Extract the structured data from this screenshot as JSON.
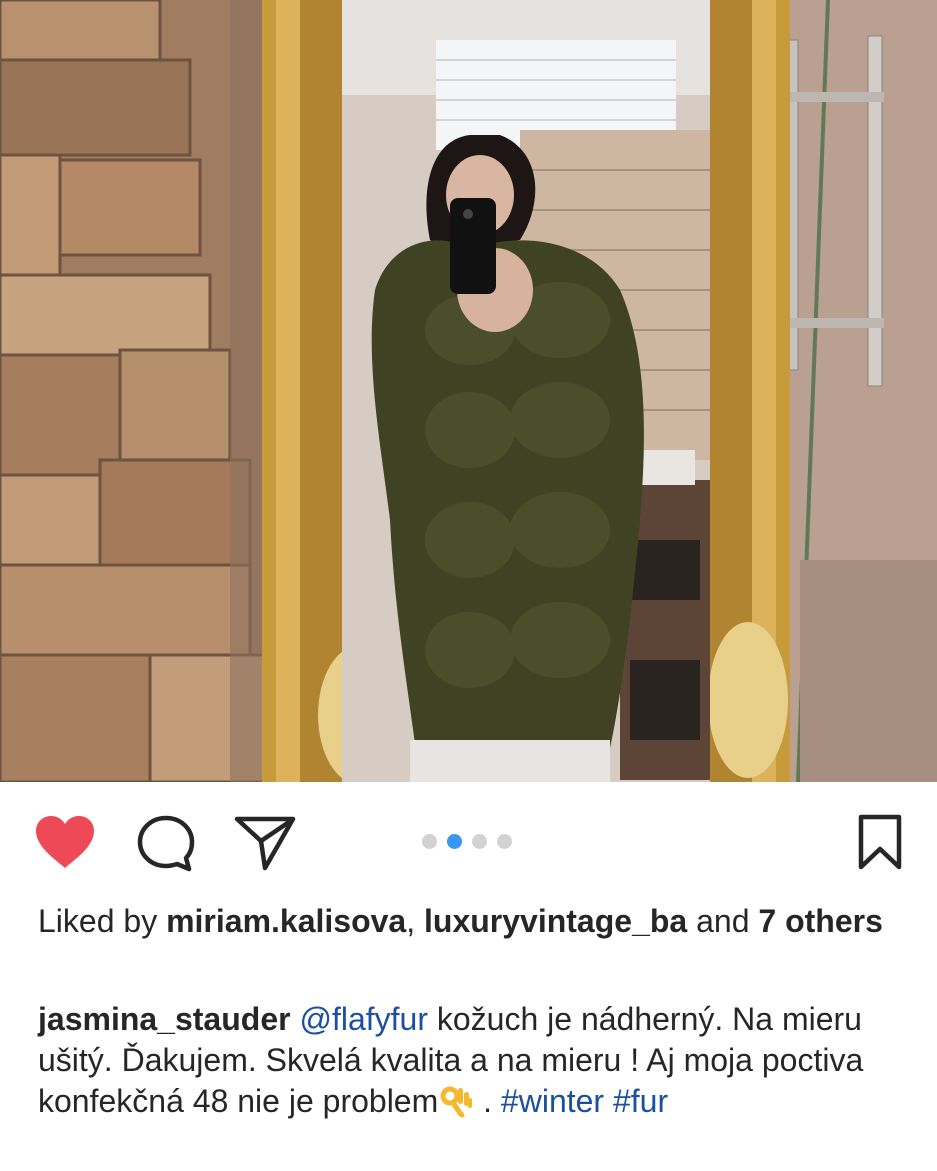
{
  "post": {
    "photo_alt_icon": "photo-content",
    "carousel": {
      "total": 4,
      "active_index": 1
    },
    "liked_by": {
      "prefix": "Liked by ",
      "user1": "miriam.kalisova",
      "separator": ", ",
      "user2": "luxuryvintage_ba",
      "and_text": " and ",
      "others_count_text": "7 others"
    },
    "caption": {
      "author": "jasmina_stauder",
      "mention": "@flafyfur",
      "text": " kožuch je nádherný. Na mieru ušitý. Ďakujem. Skvelá kvalita a na mieru ! Aj moja poctiva konfekčná 48 nie je problem",
      "emoji": "ok-hand-emoji",
      "after_emoji": " . ",
      "hashtag1": "#winter",
      "hashtag2": "#fur"
    },
    "colors": {
      "like_red": "#ed4956",
      "link_blue": "#1b4fa1",
      "dot_active": "#3897f0",
      "dot_inactive": "#d2d2d2"
    }
  }
}
